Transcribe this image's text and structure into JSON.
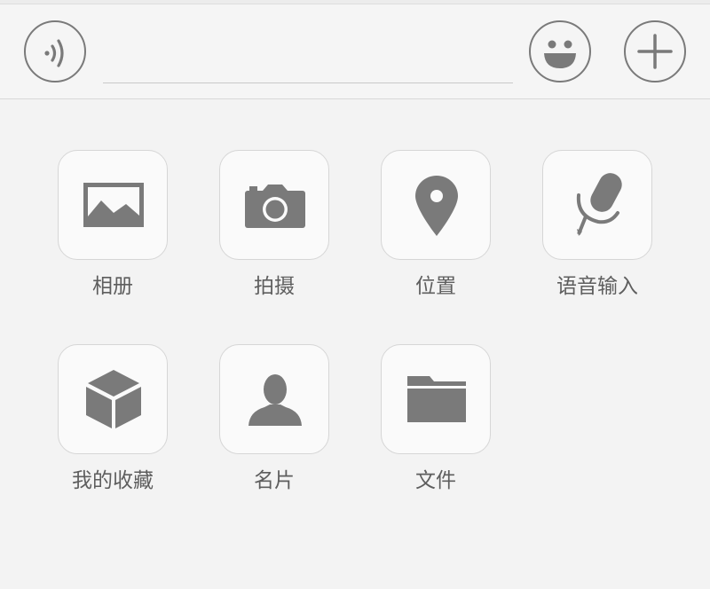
{
  "input_bar": {
    "voice_icon": "voice-wave-icon",
    "emoji_icon": "smiley-icon",
    "plus_icon": "plus-icon",
    "text_value": "",
    "placeholder": ""
  },
  "icon_color": "#7a7a7a",
  "panel": {
    "items": [
      {
        "label": "相册",
        "icon": "image-icon"
      },
      {
        "label": "拍摄",
        "icon": "camera-icon"
      },
      {
        "label": "位置",
        "icon": "location-pin-icon"
      },
      {
        "label": "语音输入",
        "icon": "microphone-icon"
      },
      {
        "label": "我的收藏",
        "icon": "cube-icon"
      },
      {
        "label": "名片",
        "icon": "contact-card-icon"
      },
      {
        "label": "文件",
        "icon": "folder-icon"
      }
    ]
  }
}
